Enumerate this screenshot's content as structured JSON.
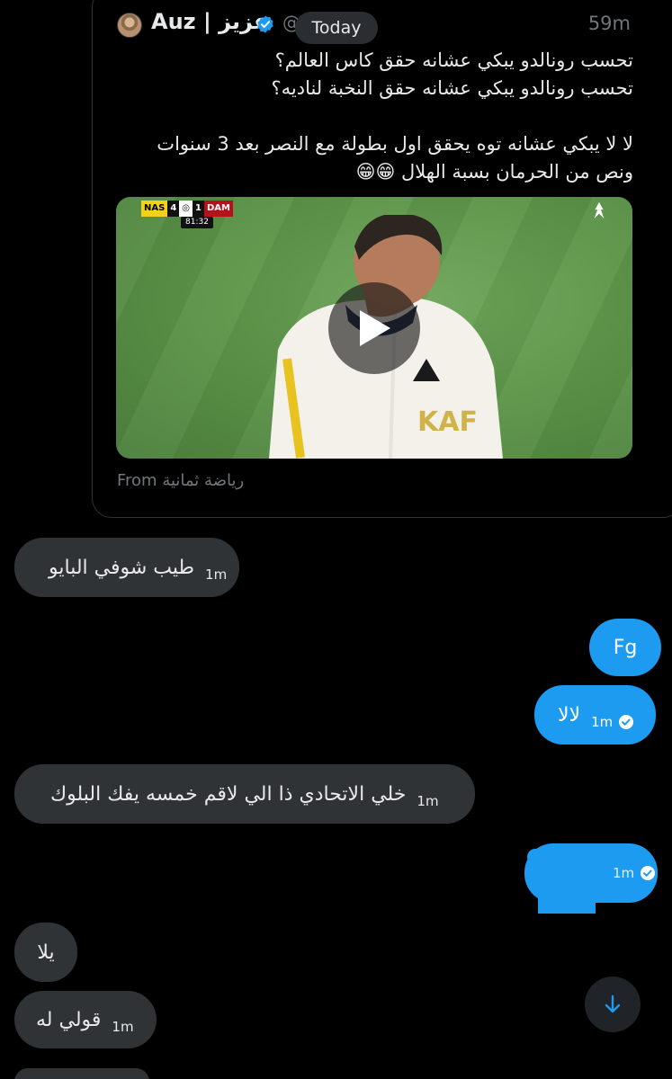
{
  "quote": {
    "author": "Auz | عزيز",
    "handle": "@",
    "time": "59m",
    "date_separator": "Today",
    "lines": [
      "تحسب رونالدو يبكي عشانه حقق كاس العالم؟",
      "تحسب رونالدو يبكي عشانه حقق النخبة لناديه؟",
      "",
      "لا لا يبكي عشانه توه يحقق اول بطولة مع النصر بعد 3 سنوات",
      "ونص من الحرمان بسبة الهلال 😁😁"
    ],
    "video": {
      "home_team": "NAS",
      "home_score": "4",
      "away_score": "1",
      "away_team": "DAM",
      "clock": "81:32",
      "jersey_text": "KAF"
    },
    "source": "From رياضة ثمانية"
  },
  "messages": [
    {
      "direction": "in",
      "text": "طيب شوفي البايو",
      "time": "1m"
    },
    {
      "direction": "out",
      "text": "Fg"
    },
    {
      "direction": "out",
      "text": "لالا",
      "time": "1m"
    },
    {
      "direction": "in",
      "text": "خلي الاتحادي ذا الي لاقم خمسه يفك البلوك",
      "time": "1m"
    },
    {
      "direction": "out",
      "text": "",
      "time": "1m",
      "note": "redacted"
    },
    {
      "direction": "in",
      "text": "يلا"
    },
    {
      "direction": "in",
      "text": "قولي له",
      "time": "1m"
    }
  ],
  "colors": {
    "accent": "#1d9bf0",
    "incoming_bubble": "#2f3336",
    "background": "#000000",
    "muted_text": "#71767b"
  },
  "icons": {
    "verified": "verified-badge-icon",
    "play": "play-icon",
    "scroll": "arrow-down-icon",
    "read": "check-circle-icon"
  }
}
